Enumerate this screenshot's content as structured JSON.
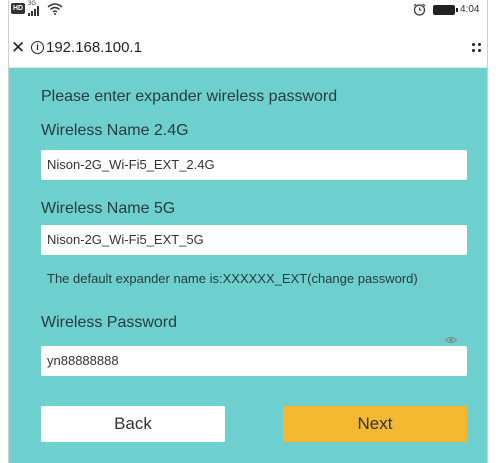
{
  "status_bar": {
    "badge": "HD",
    "network": "3G",
    "time": "4:04",
    "icons": [
      "hd-icon",
      "signal-icon",
      "wifi-icon",
      "alarm-icon",
      "battery-icon"
    ]
  },
  "browser": {
    "url": "192.168.100.1",
    "icons": [
      "close-icon",
      "info-icon",
      "menu-icon"
    ]
  },
  "form": {
    "heading": "Please enter expander wireless password",
    "name_24_label": "Wireless Name 2.4G",
    "name_24_value": "Nison-2G_Wi-Fi5_EXT_2.4G",
    "name_5_label": "Wireless Name 5G",
    "name_5_value": "Nison-2G_Wi-Fi5_EXT_5G",
    "note": "The default expander name is:XXXXXX_EXT(change password)",
    "password_label": "Wireless Password",
    "password_value": "yn88888888",
    "back_label": "Back",
    "next_label": "Next"
  },
  "colors": {
    "background": "#6ecfcf",
    "next_button": "#f5b830",
    "back_button": "#ffffff"
  }
}
